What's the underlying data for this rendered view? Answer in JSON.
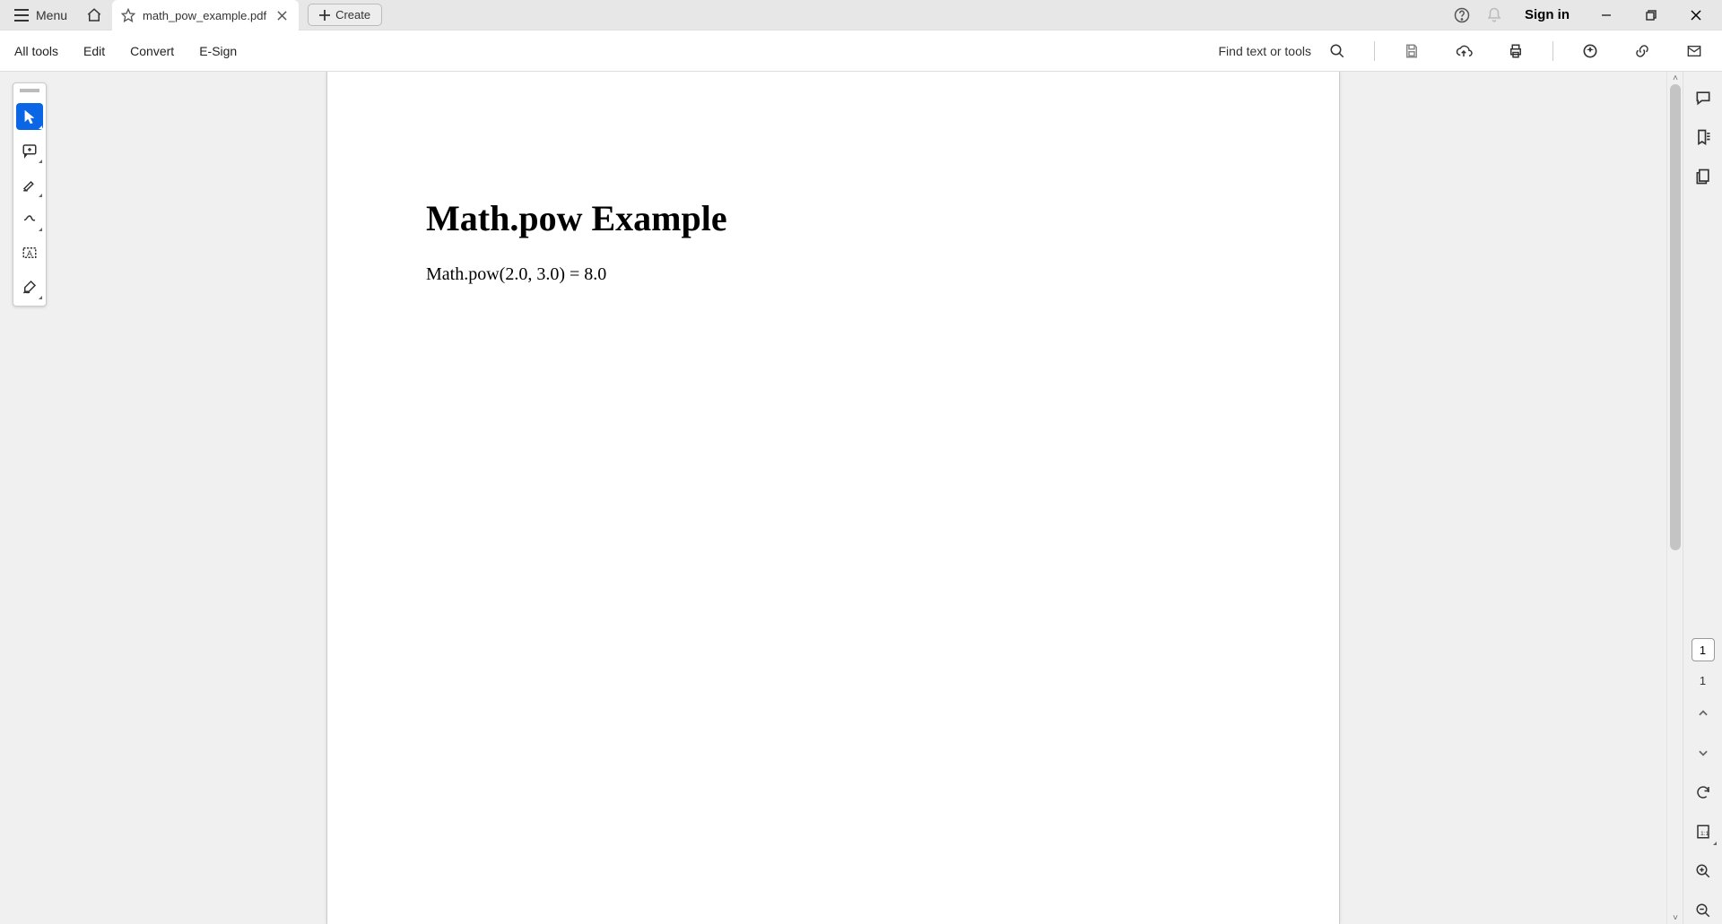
{
  "titlebar": {
    "menu_label": "Menu",
    "tab_title": "math_pow_example.pdf",
    "create_label": "Create",
    "signin_label": "Sign in"
  },
  "toolbar": {
    "all_tools": "All tools",
    "edit": "Edit",
    "convert": "Convert",
    "esign": "E-Sign",
    "find_label": "Find text or tools"
  },
  "document": {
    "heading": "Math.pow Example",
    "body": "Math.pow(2.0, 3.0) = 8.0"
  },
  "paging": {
    "current": "1",
    "total": "1"
  }
}
